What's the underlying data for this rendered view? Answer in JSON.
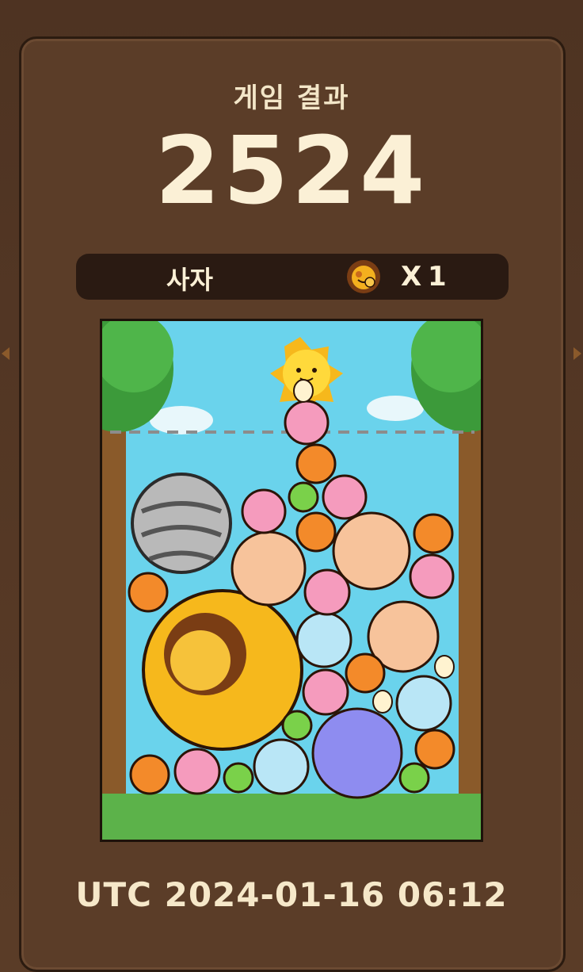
{
  "result": {
    "title": "게임 결과",
    "score": "2524",
    "animal_name": "사자",
    "animal_icon": "lion-icon",
    "count_prefix": "X",
    "count": "1",
    "timestamp": "UTC 2024-01-16 06:12"
  },
  "colors": {
    "panel": "#5b3d28",
    "bar": "#2a1a12",
    "text": "#fbf0d6",
    "sky": "#6ad3ec",
    "grass": "#5cb24a"
  }
}
